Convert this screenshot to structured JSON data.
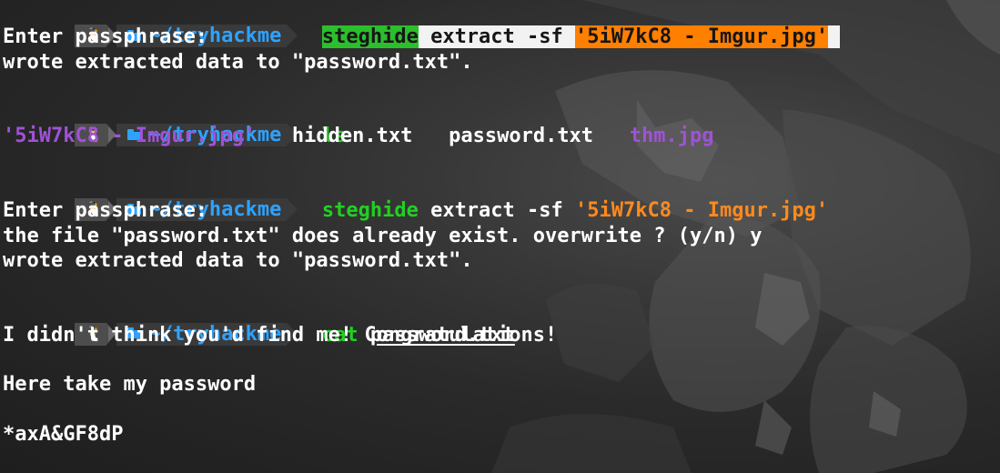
{
  "terminal": {
    "prompt": {
      "os_icon": "linux-penguin-icon",
      "dir_icon": "folder-icon",
      "path": "~/tryhackme"
    },
    "blocks": [
      {
        "command": {
          "program": "steghide",
          "args": " extract -sf ",
          "file_arg": "'5iW7kC8 - Imgur.jpg'"
        },
        "output": [
          "Enter passphrase:",
          "wrote extracted data to \"password.txt\"."
        ]
      },
      {
        "command": {
          "program": "ls"
        },
        "listing": [
          {
            "name": "'5iW7kC8 - Imgur.jpg'",
            "color": "#a052d6"
          },
          {
            "name": "hidden.txt",
            "color": "#ffffff"
          },
          {
            "name": "password.txt",
            "color": "#ffffff"
          },
          {
            "name": "thm.jpg",
            "color": "#a052d6"
          }
        ]
      },
      {
        "command": {
          "program": "steghide",
          "args": " extract -sf ",
          "file_arg": "'5iW7kC8 - Imgur.jpg'"
        },
        "output": [
          "Enter passphrase:",
          "the file \"password.txt\" does already exist. overwrite ? (y/n) y",
          "wrote extracted data to \"password.txt\"."
        ]
      },
      {
        "command": {
          "program": "cat",
          "space": " ",
          "file_arg": "password.txt"
        },
        "output": [
          "I didn't think you'd find me! Congratulations!",
          "",
          "Here take my password",
          "",
          "*axA&GF8dP"
        ]
      }
    ],
    "colors": {
      "prompt_os_bg": "#4d4d4d",
      "prompt_dir_bg": "#3a3a3a",
      "path_color": "#2ea2ff",
      "program_color": "#22d022",
      "string_color": "#ff8a1e",
      "image_file_color": "#a052d6"
    }
  }
}
